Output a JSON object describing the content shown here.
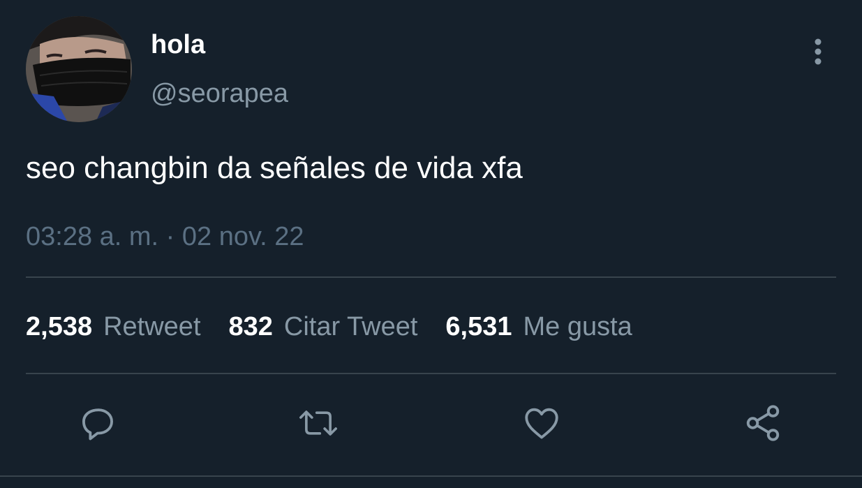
{
  "user": {
    "display_name": "hola",
    "handle": "@seorapea",
    "avatar_icon": "profile-photo"
  },
  "tweet": {
    "text": "seo changbin da señales de vida xfa",
    "timestamp": "03:28 a. m. · 02 nov. 22"
  },
  "stats": [
    {
      "count": "2,538",
      "label": "Retweet"
    },
    {
      "count": "832",
      "label": "Citar Tweet"
    },
    {
      "count": "6,531",
      "label": "Me gusta"
    }
  ],
  "actions": {
    "reply_icon": "speech-bubble-icon",
    "retweet_icon": "retweet-arrows-icon",
    "like_icon": "heart-icon",
    "share_icon": "share-icon"
  },
  "colors": {
    "background": "#15202b",
    "primary_text": "#ffffff",
    "secondary_text": "#8899a6",
    "muted_text": "#5b7083",
    "divider": "#38444d",
    "icon": "#8899a6"
  }
}
